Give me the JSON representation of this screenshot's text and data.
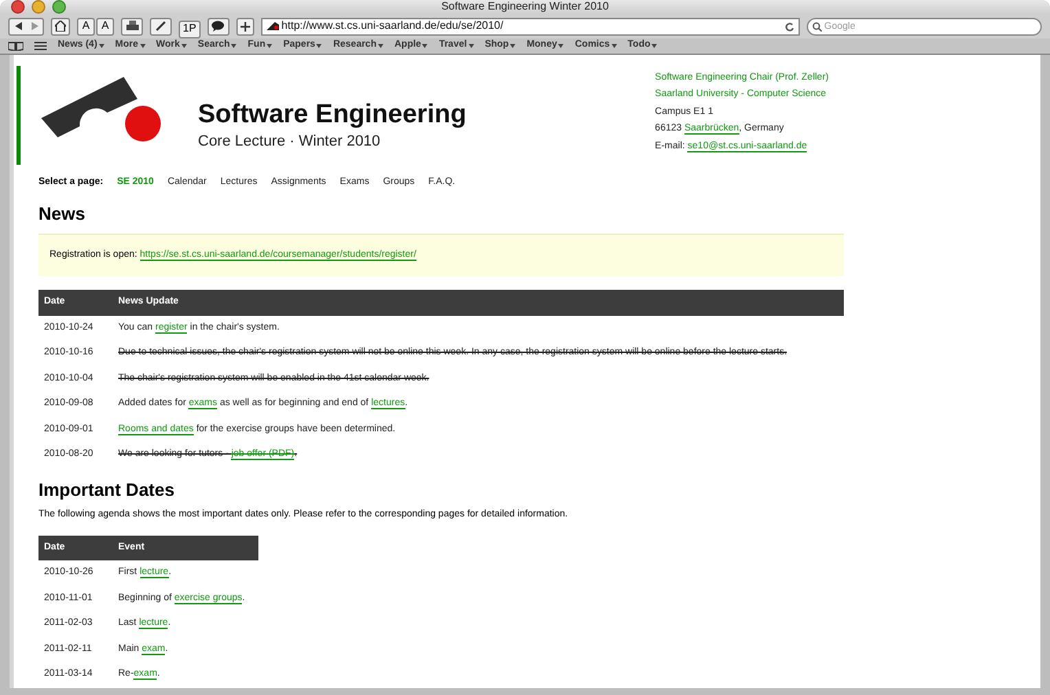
{
  "window": {
    "title": "Software Engineering Winter 2010"
  },
  "toolbar": {
    "buttons": [
      "A",
      "A",
      "1P"
    ],
    "address": "http://www.st.cs.uni-saarland.de/edu/se/2010/",
    "search_placeholder": "Google"
  },
  "bookmarks": [
    "News (4)",
    "More",
    "Work",
    "Search",
    "Fun",
    "Papers",
    "Research",
    "Apple",
    "Travel",
    "Shop",
    "Money",
    "Comics",
    "Todo"
  ],
  "page": {
    "title": "Software Engineering",
    "subtitle": "Core Lecture · Winter 2010",
    "contact": [
      [
        {
          "text": "Software Engineering Chair (Prof. Zeller)",
          "link": true
        }
      ],
      [
        {
          "text": "Saarland University - Computer Science",
          "link": true
        }
      ],
      [
        {
          "text": "Campus E1 1"
        }
      ],
      [
        {
          "text": "66123 "
        },
        {
          "text": "Saarbrücken",
          "link": true
        },
        {
          "text": ", Germany"
        }
      ],
      [
        {
          "text": "E-mail: "
        },
        {
          "text": "se10@st.cs.uni-saarland.de",
          "link": true
        }
      ]
    ],
    "nav_label": "Select a page:",
    "nav": [
      {
        "label": "SE 2010",
        "selected": true
      },
      {
        "label": "Calendar",
        "selected": false
      },
      {
        "label": "Lectures",
        "selected": false
      },
      {
        "label": "Assignments",
        "selected": false
      },
      {
        "label": "Exams",
        "selected": false
      },
      {
        "label": "Groups",
        "selected": false
      },
      {
        "label": "F.A.Q.",
        "selected": false
      }
    ],
    "news_heading": "News",
    "notice": [
      {
        "text": "Registration is open: "
      },
      {
        "text": "https://se.st.cs.uni-saarland.de/coursemanager/students/register/",
        "link": true
      }
    ],
    "news_columns": [
      "Date",
      "News Update"
    ],
    "news": [
      {
        "date": "2010-10-24",
        "struck": false,
        "text": [
          {
            "text": "You can "
          },
          {
            "text": "register",
            "link": true
          },
          {
            "text": " in the chair's system."
          }
        ]
      },
      {
        "date": "2010-10-16",
        "struck": true,
        "text": [
          {
            "text": "Due to technical issues, the chair's registration system will not be online this week. In any case, the registration system will be online before the lecture starts."
          }
        ]
      },
      {
        "date": "2010-10-04",
        "struck": true,
        "text": [
          {
            "text": "The chair's registration system will be enabled in the 41st calendar week."
          }
        ]
      },
      {
        "date": "2010-09-08",
        "struck": false,
        "text": [
          {
            "text": "Added dates for "
          },
          {
            "text": "exams",
            "link": true
          },
          {
            "text": " as well as for beginning and end of "
          },
          {
            "text": "lectures",
            "link": true
          },
          {
            "text": "."
          }
        ]
      },
      {
        "date": "2010-09-01",
        "struck": false,
        "text": [
          {
            "text": "Rooms and dates",
            "link": true
          },
          {
            "text": " for the exercise groups have been determined."
          }
        ]
      },
      {
        "date": "2010-08-20",
        "struck": true,
        "text": [
          {
            "text": "We are looking for tutors - "
          },
          {
            "text": "job offer (PDF)",
            "link": true
          },
          {
            "text": "."
          }
        ]
      }
    ],
    "dates_heading": "Important Dates",
    "dates_intro": "The following agenda shows the most important dates only. Please refer to the corresponding pages for detailed information.",
    "dates_columns": [
      "Date",
      "Event"
    ],
    "dates": [
      {
        "date": "2010-10-26",
        "text": [
          {
            "text": "First "
          },
          {
            "text": "lecture",
            "link": true
          },
          {
            "text": "."
          }
        ]
      },
      {
        "date": "2010-11-01",
        "text": [
          {
            "text": "Beginning of "
          },
          {
            "text": "exercise groups",
            "link": true
          },
          {
            "text": "."
          }
        ]
      },
      {
        "date": "2011-02-03",
        "text": [
          {
            "text": "Last "
          },
          {
            "text": "lecture",
            "link": true
          },
          {
            "text": "."
          }
        ]
      },
      {
        "date": "2011-02-11",
        "text": [
          {
            "text": "Main "
          },
          {
            "text": "exam",
            "link": true
          },
          {
            "text": "."
          }
        ]
      },
      {
        "date": "2011-03-14",
        "text": [
          {
            "text": "Re-"
          },
          {
            "text": "exam",
            "link": true
          },
          {
            "text": "."
          }
        ]
      }
    ]
  }
}
